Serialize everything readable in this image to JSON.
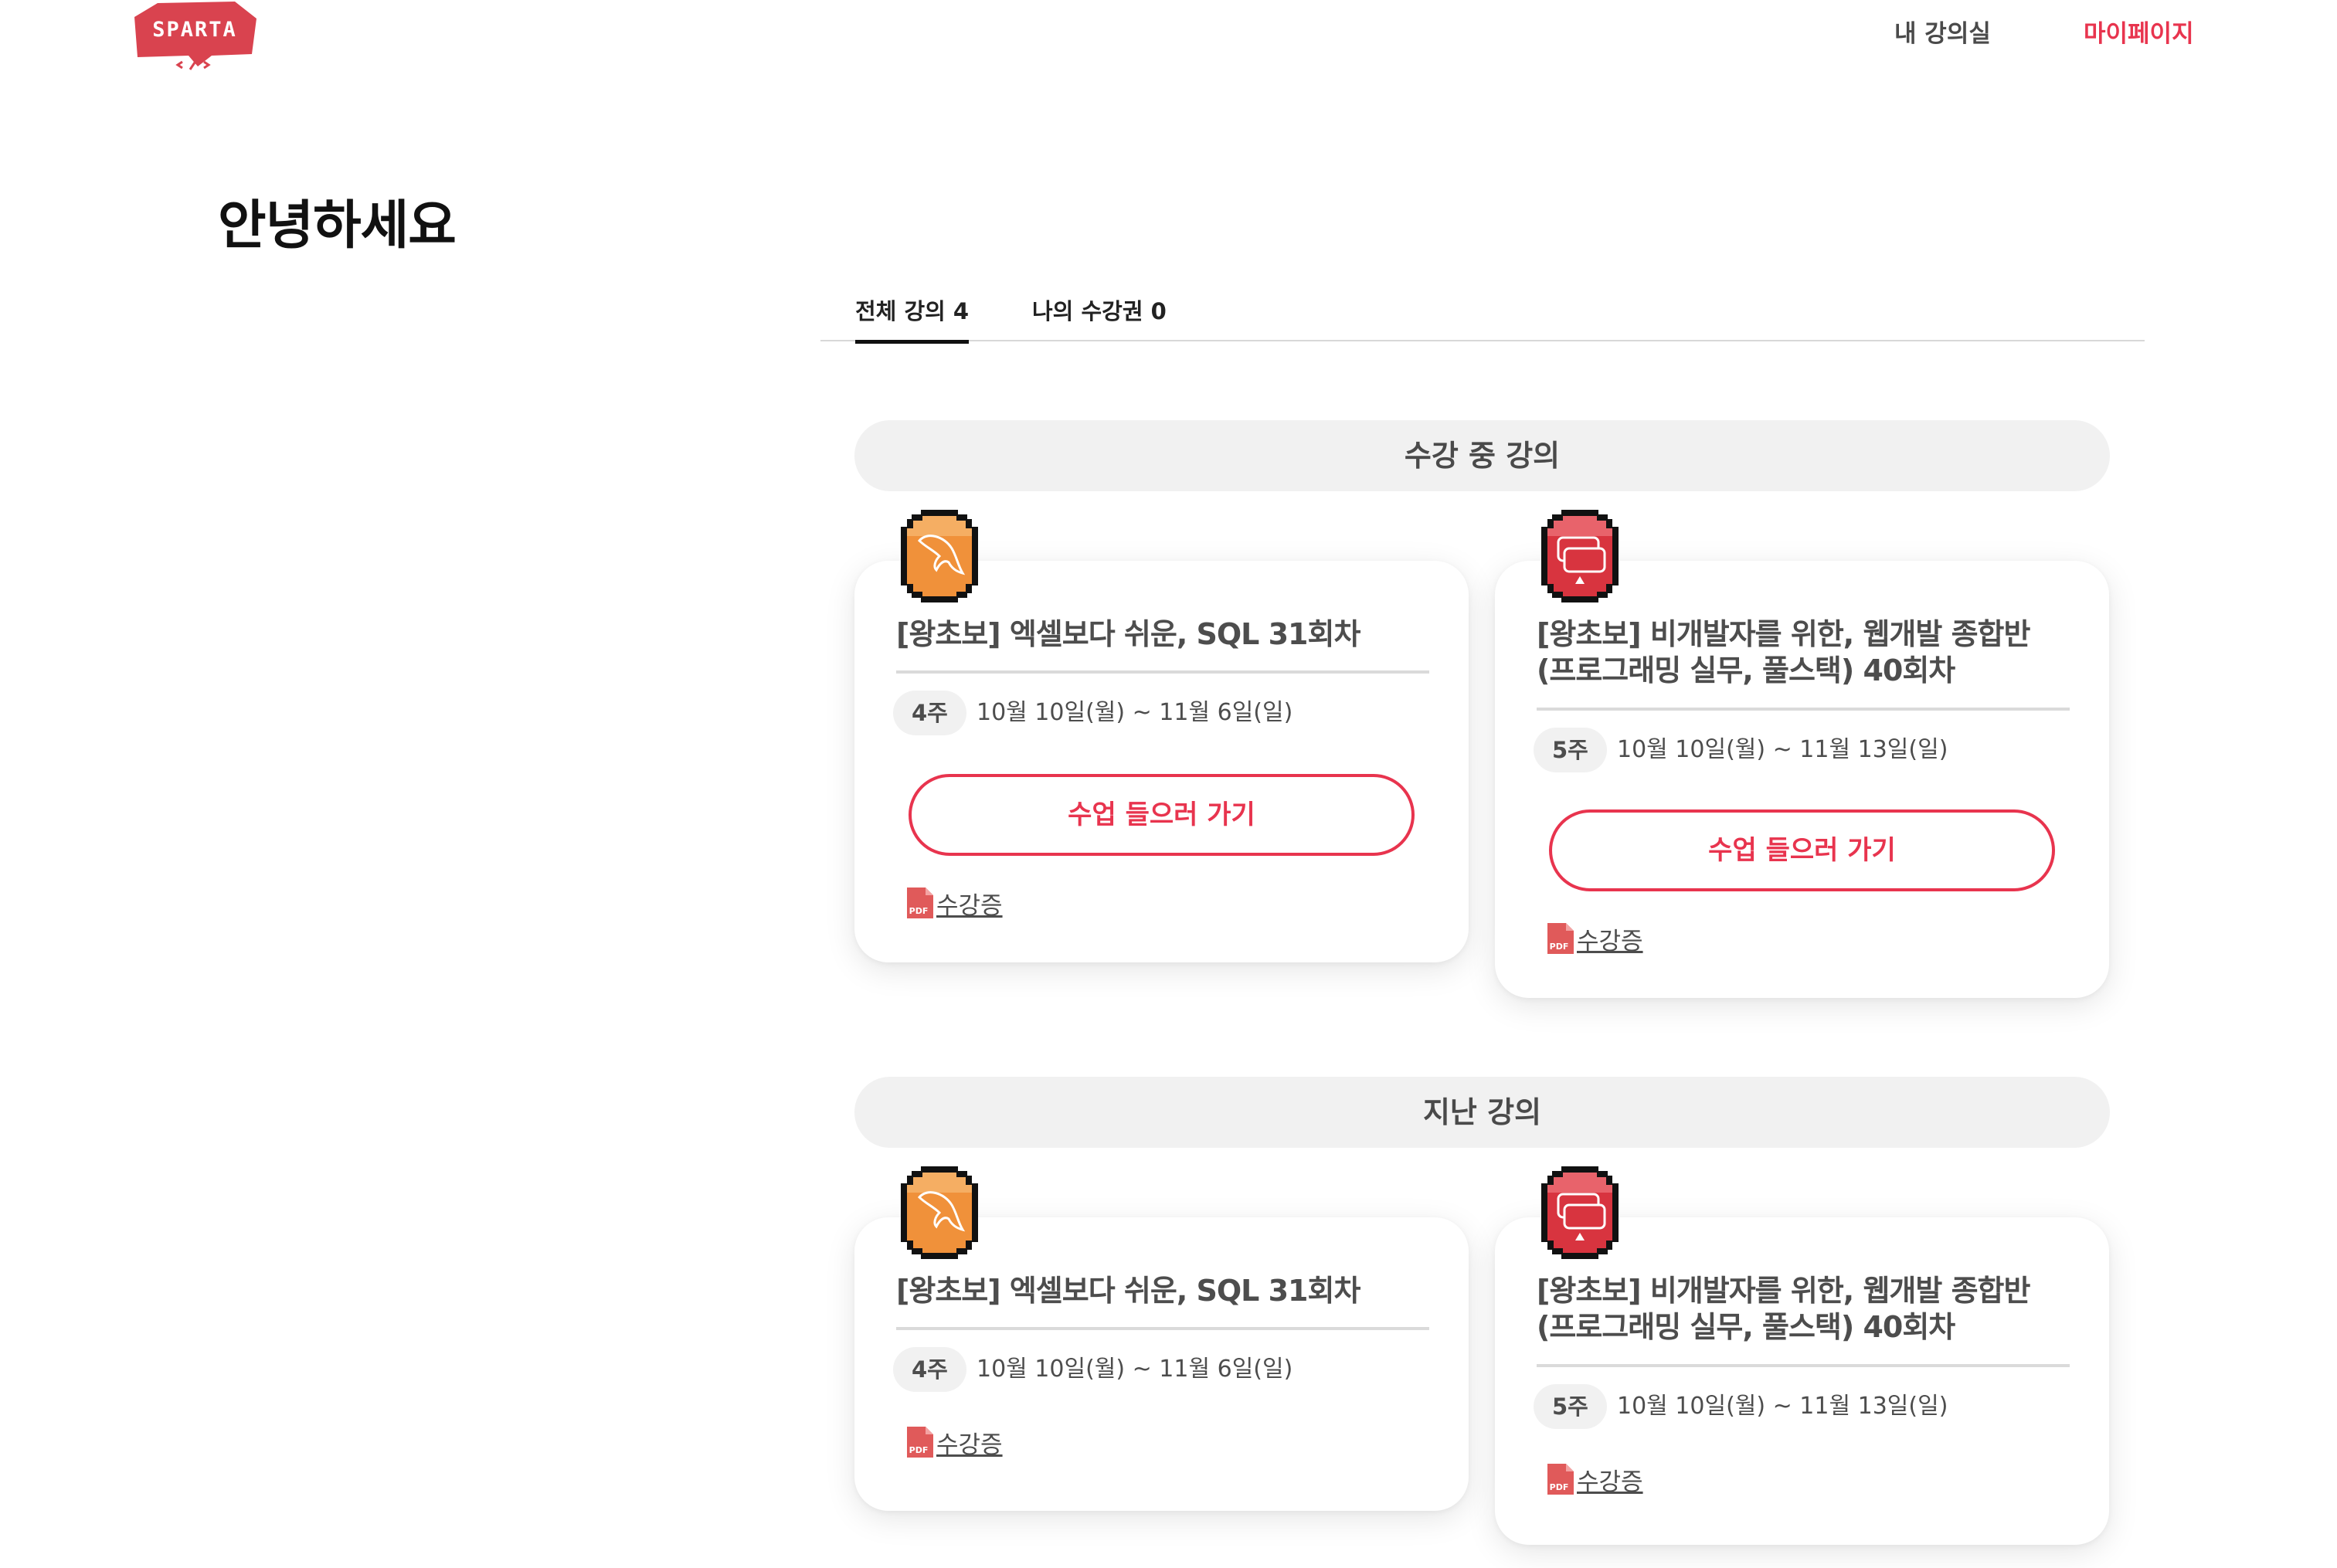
{
  "header": {
    "logo_text": "SPARTA",
    "nav": {
      "classroom": "내 강의실",
      "mypage": "마이페이지"
    },
    "accent_color": "#e8344e"
  },
  "greeting": "안녕하세요",
  "tabs": [
    {
      "label": "전체 강의 4",
      "selected": true
    },
    {
      "label": "나의 수강권 0",
      "selected": false
    }
  ],
  "sections": [
    {
      "title": "수강 중 강의",
      "courses": [
        {
          "badge": "mysql-dolphin-icon",
          "badge_color": "#f0913a",
          "title": "[왕초보] 엑셀보다 쉬운, SQL 31회차",
          "weeks": "4주",
          "period": "10월 10일(월) ~ 11월 6일(일)",
          "button": "수업 들으러 가기",
          "certificate": "수강증"
        },
        {
          "badge": "web-dev-icon",
          "badge_color": "#d8343f",
          "title": "[왕초보] 비개발자를 위한, 웹개발 종합반 (프로그래밍 실무, 풀스택) 40회차",
          "weeks": "5주",
          "period": "10월 10일(월) ~ 11월 13일(일)",
          "button": "수업 들으러 가기",
          "certificate": "수강증"
        }
      ]
    },
    {
      "title": "지난 강의",
      "courses": [
        {
          "badge": "mysql-dolphin-icon",
          "badge_color": "#f0913a",
          "title": "[왕초보] 엑셀보다 쉬운, SQL 31회차",
          "weeks": "4주",
          "period": "10월 10일(월) ~ 11월 6일(일)",
          "certificate": "수강증"
        },
        {
          "badge": "web-dev-icon",
          "badge_color": "#d8343f",
          "title": "[왕초보] 비개발자를 위한, 웹개발 종합반 (프로그래밍 실무, 풀스택) 40회차",
          "weeks": "5주",
          "period": "10월 10일(월) ~ 11월 13일(일)",
          "certificate": "수강증"
        }
      ]
    }
  ],
  "pdf_icon_label": "PDF"
}
